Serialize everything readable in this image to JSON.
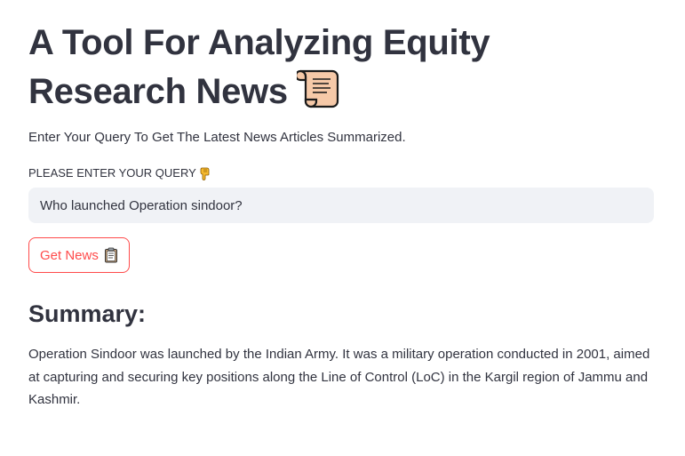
{
  "header": {
    "title": "A Tool For Analyzing Equity Research News",
    "title_icon": "scroll-icon"
  },
  "subtitle": "Enter Your Query To Get The Latest News Articles Summarized.",
  "query": {
    "label": "PLEASE ENTER YOUR QUERY",
    "label_icon": "pointing-down-hand-icon",
    "value": "Who launched Operation sindoor?"
  },
  "actions": {
    "get_news_label": "Get News",
    "get_news_icon": "clipboard-icon"
  },
  "summary": {
    "heading": "Summary:",
    "text": "Operation Sindoor was launched by the Indian Army. It was a military operation conducted in 2001, aimed at capturing and securing key positions along the Line of Control (LoC) in the Kargil region of Jammu and Kashmir."
  },
  "colors": {
    "text": "#31333f",
    "accent": "#ff4b4b",
    "input_bg": "#f0f2f6"
  }
}
